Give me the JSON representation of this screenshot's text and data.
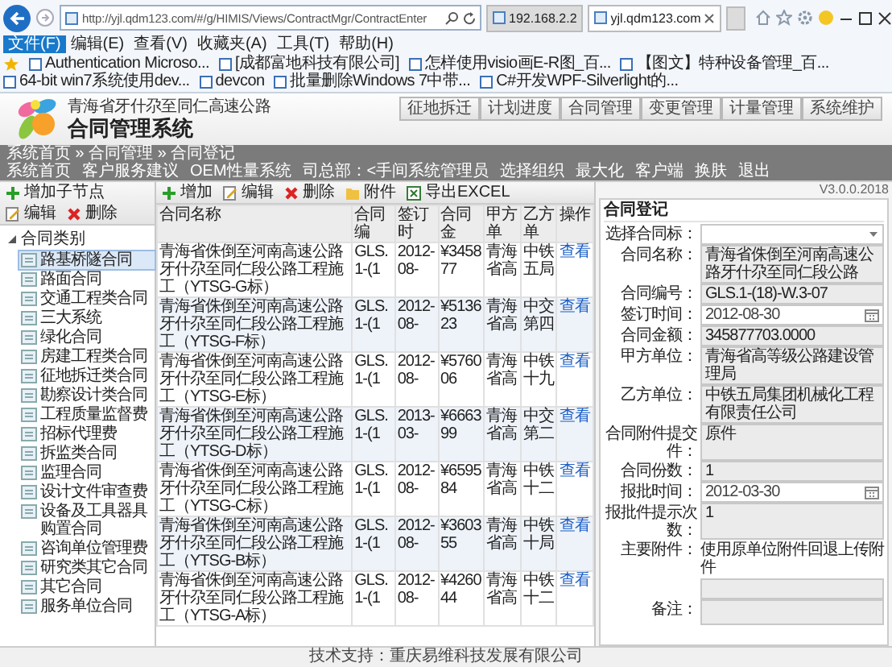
{
  "browser": {
    "address": "http://yjl.qdm123.com/#/g/HIMIS/Views/ContractMgr/ContractEnter",
    "tabs": [
      {
        "label": "192.168.2.2",
        "selected": false
      },
      {
        "label": "yjl.qdm123.com",
        "selected": true
      }
    ],
    "menu": [
      {
        "label": "文件(F)",
        "selected": true
      },
      {
        "label": "编辑(E)",
        "selected": false
      },
      {
        "label": "查看(V)",
        "selected": false
      },
      {
        "label": "收藏夹(A)",
        "selected": false
      },
      {
        "label": "工具(T)",
        "selected": false
      },
      {
        "label": "帮助(H)",
        "selected": false
      }
    ],
    "favorites": [
      "Authentication  Microso...",
      "[成都富地科技有限公司]",
      "怎样使用visio画E-R图_百...",
      "【图文】特种设备管理_百...",
      "64-bit win7系统使用dev...",
      "devcon",
      "批量删除Windows 7中带...",
      "C#开发WPF-Silverlight的..."
    ]
  },
  "header": {
    "subtitle": "青海省牙什尕至同仁高速公路",
    "title": "合同管理系统",
    "modules": [
      "征地拆迁",
      "计划进度",
      "合同管理",
      "变更管理",
      "计量管理",
      "系统维护"
    ]
  },
  "nav": {
    "breadcrumb": "系统首页 » 合同管理 » 合同登记",
    "links": [
      "系统首页",
      "客户服务建议",
      "OEM性量系统",
      "司总部：<手间系统管理员",
      "选择组织",
      "最大化",
      "客户端",
      "换肤",
      "退出"
    ]
  },
  "tree_toolbar": [
    {
      "kind": "add",
      "label": "增加子节点"
    },
    {
      "kind": "edit",
      "label": "编辑"
    },
    {
      "kind": "delete",
      "label": "删除"
    }
  ],
  "tree": {
    "label": "合同类别",
    "expanded": true,
    "children": [
      {
        "label": "路基桥隧合同",
        "selected": true
      },
      {
        "label": "路面合同",
        "selected": false
      },
      {
        "label": "交通工程类合同",
        "selected": false
      },
      {
        "label": "三大系统",
        "selected": false
      },
      {
        "label": "绿化合同",
        "selected": false
      },
      {
        "label": "房建工程类合同",
        "selected": false
      },
      {
        "label": "征地拆迁类合同",
        "selected": false
      },
      {
        "label": "勘察设计类合同",
        "selected": false
      },
      {
        "label": "工程质量监督费",
        "selected": false
      },
      {
        "label": "招标代理费",
        "selected": false
      },
      {
        "label": "拆监类合同",
        "selected": false
      },
      {
        "label": "监理合同",
        "selected": false
      },
      {
        "label": "设计文件审查费",
        "selected": false
      },
      {
        "label": "设备及工具器具购置合同",
        "selected": false
      },
      {
        "label": "咨询单位管理费",
        "selected": false
      },
      {
        "label": "研究类其它合同",
        "selected": false
      },
      {
        "label": "其它合同",
        "selected": false
      },
      {
        "label": "服务单位合同",
        "selected": false
      }
    ]
  },
  "table_toolbar": [
    {
      "kind": "add",
      "label": "增加"
    },
    {
      "kind": "edit",
      "label": "编辑"
    },
    {
      "kind": "delete",
      "label": "删除"
    },
    {
      "kind": "attach",
      "label": "附件"
    },
    {
      "kind": "export",
      "label": "导出EXCEL"
    }
  ],
  "table": {
    "columns": [
      "合同名称",
      "合同编",
      "签订时",
      "合同金",
      "甲方单",
      "乙方单",
      "操作"
    ],
    "rows": [
      {
        "cells": [
          "青海省侏倒至河南高速公路牙什尕至同仁段公路工程施工（YTSG-G标）",
          "GLS.1-(1",
          "2012-08-",
          "¥345877",
          "青海省高",
          "中铁五局"
        ],
        "action": "查看"
      },
      {
        "cells": [
          "青海省侏倒至河南高速公路牙什尕至同仁段公路工程施工（YTSG-F标）",
          "GLS.1-(1",
          "2012-08-",
          "¥513623",
          "青海省高",
          "中交第四"
        ],
        "action": "查看"
      },
      {
        "cells": [
          "青海省侏倒至河南高速公路牙什尕至同仁段公路工程施工（YTSG-E标）",
          "GLS.1-(1",
          "2012-08-",
          "¥576006",
          "青海省高",
          "中铁十九"
        ],
        "action": "查看"
      },
      {
        "cells": [
          "青海省侏倒至河南高速公路牙什尕至同仁段公路工程施工（YTSG-D标）",
          "GLS.1-(1",
          "2013-03-",
          "¥666399",
          "青海省高",
          "中交第二"
        ],
        "action": "查看"
      },
      {
        "cells": [
          "青海省侏倒至河南高速公路牙什尕至同仁段公路工程施工（YTSG-C标）",
          "GLS.1-(1",
          "2012-08-",
          "¥659584",
          "青海省高",
          "中铁十二"
        ],
        "action": "查看"
      },
      {
        "cells": [
          "青海省侏倒至河南高速公路牙什尕至同仁段公路工程施工（YTSG-B标）",
          "GLS.1-(1",
          "2012-08-",
          "¥360355",
          "青海省高",
          "中铁十局"
        ],
        "action": "查看"
      },
      {
        "cells": [
          "青海省侏倒至河南高速公路牙什尕至同仁段公路工程施工（YTSG-A标）",
          "GLS.1-(1",
          "2012-08-",
          "¥426044",
          "青海省高",
          "中铁十二"
        ],
        "action": "查看"
      }
    ]
  },
  "version": "V3.0.0.2018",
  "form": {
    "title": "合同登记",
    "fields": [
      {
        "label": "选择合同标：",
        "kind": "select",
        "disabled": false
      },
      {
        "label": "合同名称：",
        "kind": "text",
        "disabled": true,
        "value": "青海省侏倒至河南高速公路牙什尕至同仁段公路"
      },
      {
        "label": "合同编号：",
        "kind": "text",
        "disabled": true,
        "value": "GLS.1-(18)-W.3-07"
      },
      {
        "label": "签订时间：",
        "kind": "date",
        "disabled": false,
        "value": "2012-08-30"
      },
      {
        "label": "合同金额：",
        "kind": "text",
        "disabled": true,
        "value": "345877703.0000"
      },
      {
        "label": "甲方单位：",
        "kind": "text",
        "disabled": true,
        "value": "青海省高等级公路建设管理局"
      },
      {
        "label": "乙方单位：",
        "kind": "text",
        "disabled": true,
        "value": "中铁五局集团机械化工程有限责任公司"
      },
      {
        "label": "合同附件提交件：",
        "kind": "text",
        "disabled": true,
        "value": "原件"
      },
      {
        "label": "合同份数：",
        "kind": "text",
        "disabled": true,
        "value": "1"
      },
      {
        "label": "报批时间：",
        "kind": "date",
        "disabled": false,
        "value": "2012-03-30"
      },
      {
        "label": "报批件提示次数：",
        "kind": "text",
        "disabled": true,
        "value": "1"
      },
      {
        "label": "主要附件：",
        "kind": "note",
        "disabled": true,
        "value": "使用原单位附件回退上传附件"
      },
      {
        "label": "备注：",
        "kind": "textarea",
        "disabled": true
      }
    ]
  },
  "footer": "技术支持：重庆易维科技发展有限公司"
}
